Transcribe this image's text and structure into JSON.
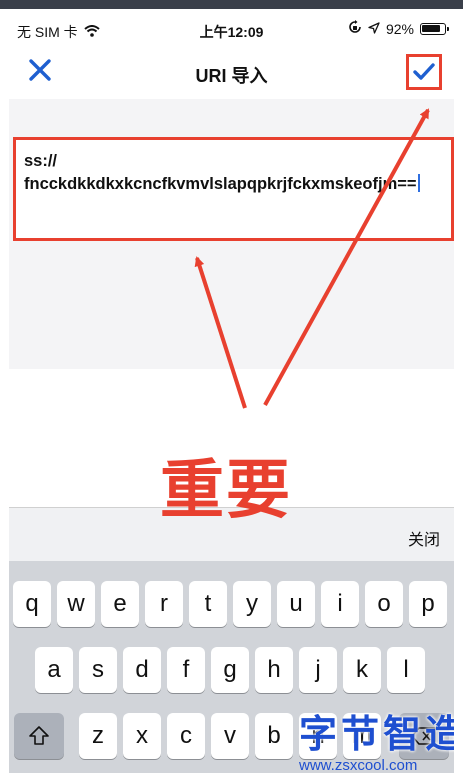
{
  "status_bar": {
    "carrier": "无 SIM 卡",
    "time": "上午12:09",
    "battery": "92%",
    "battery_level": 0.92
  },
  "nav": {
    "title": "URI 导入"
  },
  "uri_input": {
    "value": "ss://\nfncckdkkdkxkcncfkvmvlslapqpkrjfckxmskeofjm=="
  },
  "annotation": {
    "label": "重要",
    "color": "#e8402f"
  },
  "accessory": {
    "close_label": "关闭"
  },
  "keyboard": {
    "row1": [
      "q",
      "w",
      "e",
      "r",
      "t",
      "y",
      "u",
      "i",
      "o",
      "p"
    ],
    "row2": [
      "a",
      "s",
      "d",
      "f",
      "g",
      "h",
      "j",
      "k",
      "l"
    ],
    "row3": [
      "z",
      "x",
      "c",
      "v",
      "b",
      "n",
      "m"
    ]
  },
  "watermark": {
    "text": "字节智造",
    "url": "www.zsxcool.com"
  },
  "colors": {
    "accent": "#1e5fd0",
    "annotation_red": "#e8402f",
    "keyboard_bg": "#d1d4d9"
  }
}
